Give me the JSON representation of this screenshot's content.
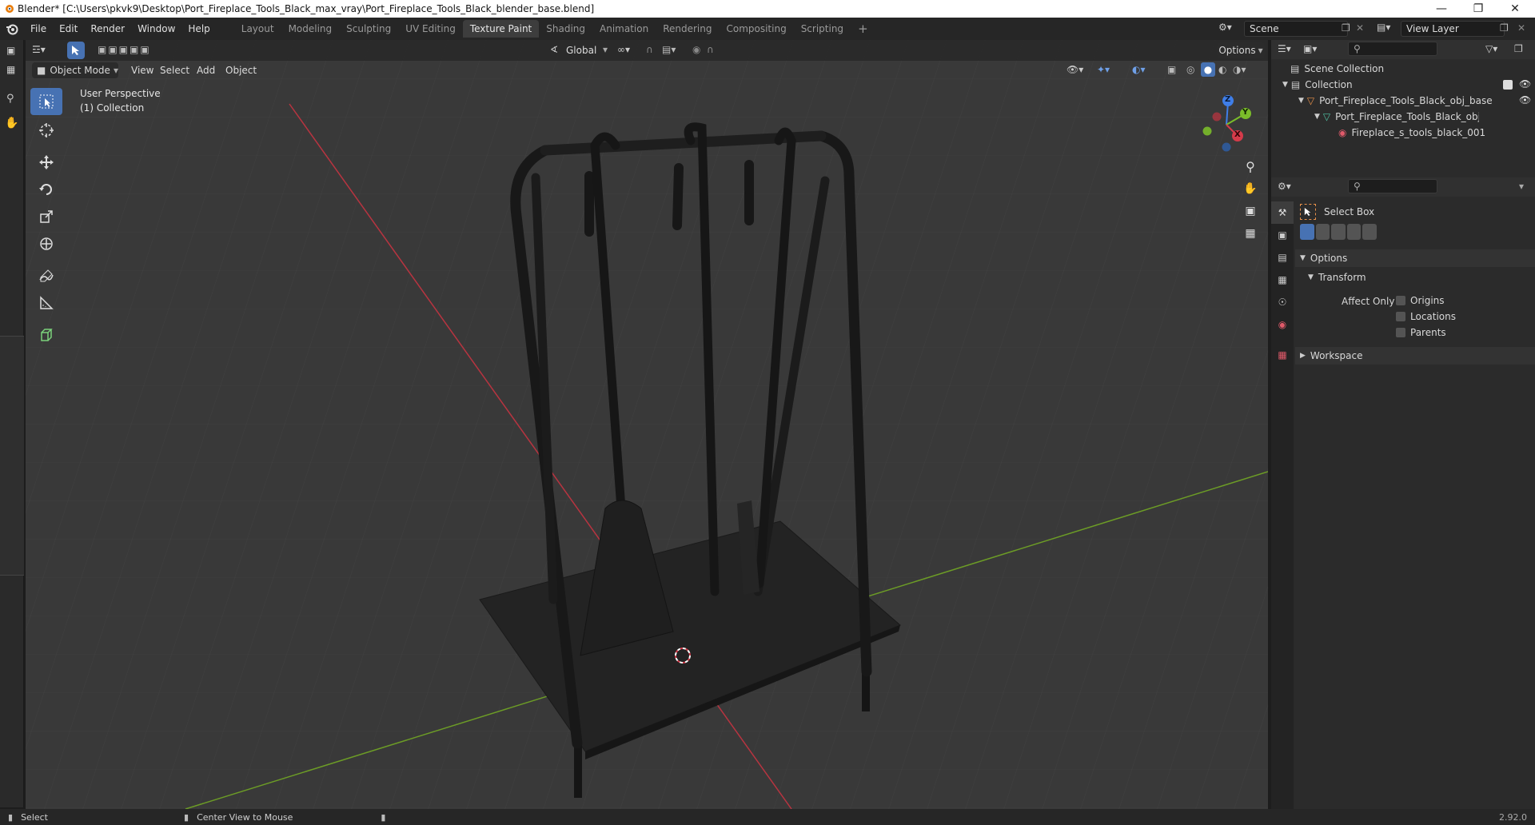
{
  "window": {
    "title": "Blender* [C:\\Users\\pkvk9\\Desktop\\Port_Fireplace_Tools_Black_max_vray\\Port_Fireplace_Tools_Black_blender_base.blend]"
  },
  "menu": [
    "File",
    "Edit",
    "Render",
    "Window",
    "Help"
  ],
  "workspaces": [
    {
      "label": "Layout",
      "active": false
    },
    {
      "label": "Modeling",
      "active": false
    },
    {
      "label": "Sculpting",
      "active": false
    },
    {
      "label": "UV Editing",
      "active": false
    },
    {
      "label": "Texture Paint",
      "active": true
    },
    {
      "label": "Shading",
      "active": false
    },
    {
      "label": "Animation",
      "active": false
    },
    {
      "label": "Rendering",
      "active": false
    },
    {
      "label": "Compositing",
      "active": false
    },
    {
      "label": "Scripting",
      "active": false
    }
  ],
  "scene": {
    "name": "Scene",
    "view_layer": "View Layer"
  },
  "viewport_header": {
    "transform_orientation": "Global",
    "options_label": "Options",
    "mode": "Object Mode",
    "menus": [
      "View",
      "Select",
      "Add",
      "Object"
    ]
  },
  "viewport": {
    "perspective": "User Perspective",
    "collection": "(1) Collection"
  },
  "gizmo": {
    "x": "X",
    "y": "Y",
    "z": "Z"
  },
  "outliner": {
    "scene_collection": "Scene Collection",
    "rows": [
      {
        "label": "Collection"
      },
      {
        "label": "Port_Fireplace_Tools_Black_obj_base"
      },
      {
        "label": "Port_Fireplace_Tools_Black_obj_base"
      },
      {
        "label": "Fireplace_s_tools_black_001"
      }
    ]
  },
  "properties": {
    "tool_name": "Select Box",
    "options_panel": "Options",
    "transform_panel": "Transform",
    "affect_only_label": "Affect Only",
    "checkboxes": [
      {
        "label": "Origins",
        "checked": false
      },
      {
        "label": "Locations",
        "checked": false
      },
      {
        "label": "Parents",
        "checked": false
      }
    ],
    "workspace_panel": "Workspace"
  },
  "status": {
    "select_label": "Select",
    "center_view_label": "Center View to Mouse",
    "version": "2.92.0"
  },
  "colors": {
    "accent": "#4772b3",
    "axis_x": "#d43b4a",
    "axis_y": "#7bbd2a",
    "axis_z": "#3f7ee8",
    "grid_bg": "#393939"
  }
}
